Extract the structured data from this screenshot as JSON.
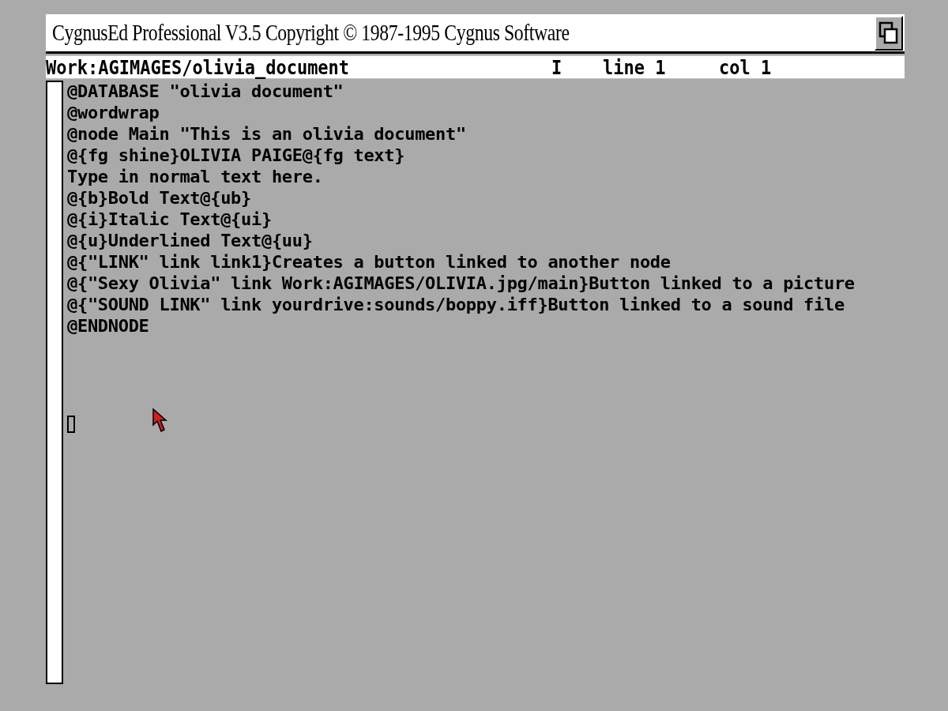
{
  "window": {
    "title": "CygnusEd Professional V3.5 Copyright © 1987-1995 Cygnus Software"
  },
  "status_bar": {
    "file": "Work:AGIMAGES/olivia_document",
    "mode": "I",
    "line": "line 1",
    "column": "col 1"
  },
  "editor": {
    "lines": [
      "@DATABASE \"olivia document\"",
      "@wordwrap",
      "@node Main \"This is an olivia document\"",
      "@{fg shine}OLIVIA PAIGE@{fg text}",
      "Type in normal text here.",
      "@{b}Bold Text@{ub}",
      "@{i}Italic Text@{ui}",
      "@{u}Underlined Text@{uu}",
      "@{\"LINK\" link link1}Creates a button linked to another node",
      "@{\"Sexy Olivia\" link Work:AGIMAGES/OLIVIA.jpg/main}Button linked to a picture",
      "@{\"SOUND LINK\" link yourdrive:sounds/boppy.iff}Button linked to a sound file",
      "@ENDNODE"
    ]
  }
}
